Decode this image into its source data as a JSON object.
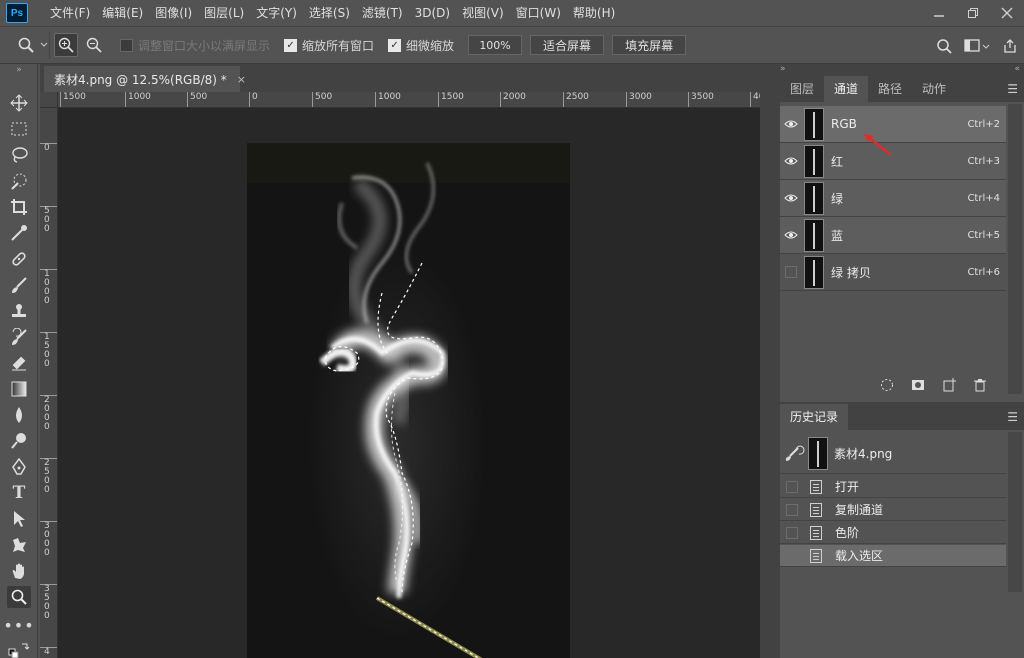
{
  "app": {
    "logo": "Ps",
    "menu": [
      "文件(F)",
      "编辑(E)",
      "图像(I)",
      "图层(L)",
      "文字(Y)",
      "选择(S)",
      "滤镜(T)",
      "3D(D)",
      "视图(V)",
      "窗口(W)",
      "帮助(H)"
    ],
    "window_controls": [
      "minimize",
      "restore",
      "close"
    ]
  },
  "options_bar": {
    "resize_windows_label": "调整窗口大小以满屏显示",
    "resize_windows_checked": false,
    "zoom_all_label": "缩放所有窗口",
    "zoom_all_checked": true,
    "scrubby_zoom_label": "细微缩放",
    "scrubby_zoom_checked": true,
    "zoom_value": "100%",
    "fit_screen_label": "适合屏幕",
    "fill_screen_label": "填充屏幕"
  },
  "document": {
    "tab_title": "素材4.png @ 12.5%(RGB/8) *",
    "close_glyph": "×"
  },
  "rulers": {
    "horizontal": [
      "1500",
      "1000",
      "500",
      "0",
      "500",
      "1000",
      "1500",
      "2000",
      "2500",
      "3000",
      "3500",
      "40"
    ],
    "vertical": [
      "0",
      "5\n0\n0",
      "1\n0\n0\n0",
      "1\n5\n0\n0",
      "2\n0\n0\n0",
      "2\n5\n0\n0",
      "3\n0\n0\n0",
      "3\n5\n0\n0",
      "4"
    ]
  },
  "channels_panel": {
    "tabs": [
      "图层",
      "通道",
      "路径",
      "动作"
    ],
    "active_tab": "通道",
    "channels": [
      {
        "name": "RGB",
        "shortcut": "Ctrl+2",
        "visible": true,
        "selected": true
      },
      {
        "name": "红",
        "shortcut": "Ctrl+3",
        "visible": true,
        "selected": false
      },
      {
        "name": "绿",
        "shortcut": "Ctrl+4",
        "visible": true,
        "selected": false
      },
      {
        "name": "蓝",
        "shortcut": "Ctrl+5",
        "visible": true,
        "selected": false
      },
      {
        "name": "绿 拷贝",
        "shortcut": "Ctrl+6",
        "visible": false,
        "selected": false
      }
    ]
  },
  "history_panel": {
    "title": "历史记录",
    "snapshot": "素材4.png",
    "steps": [
      "打开",
      "复制通道",
      "色阶",
      "载入选区"
    ],
    "active_step": "载入选区"
  },
  "colors": {
    "ui_bg": "#535353",
    "panel_dark": "#424242",
    "canvas_bg": "#282828",
    "image_bg": "#141414",
    "annotation_arrow": "#e02b2b"
  }
}
